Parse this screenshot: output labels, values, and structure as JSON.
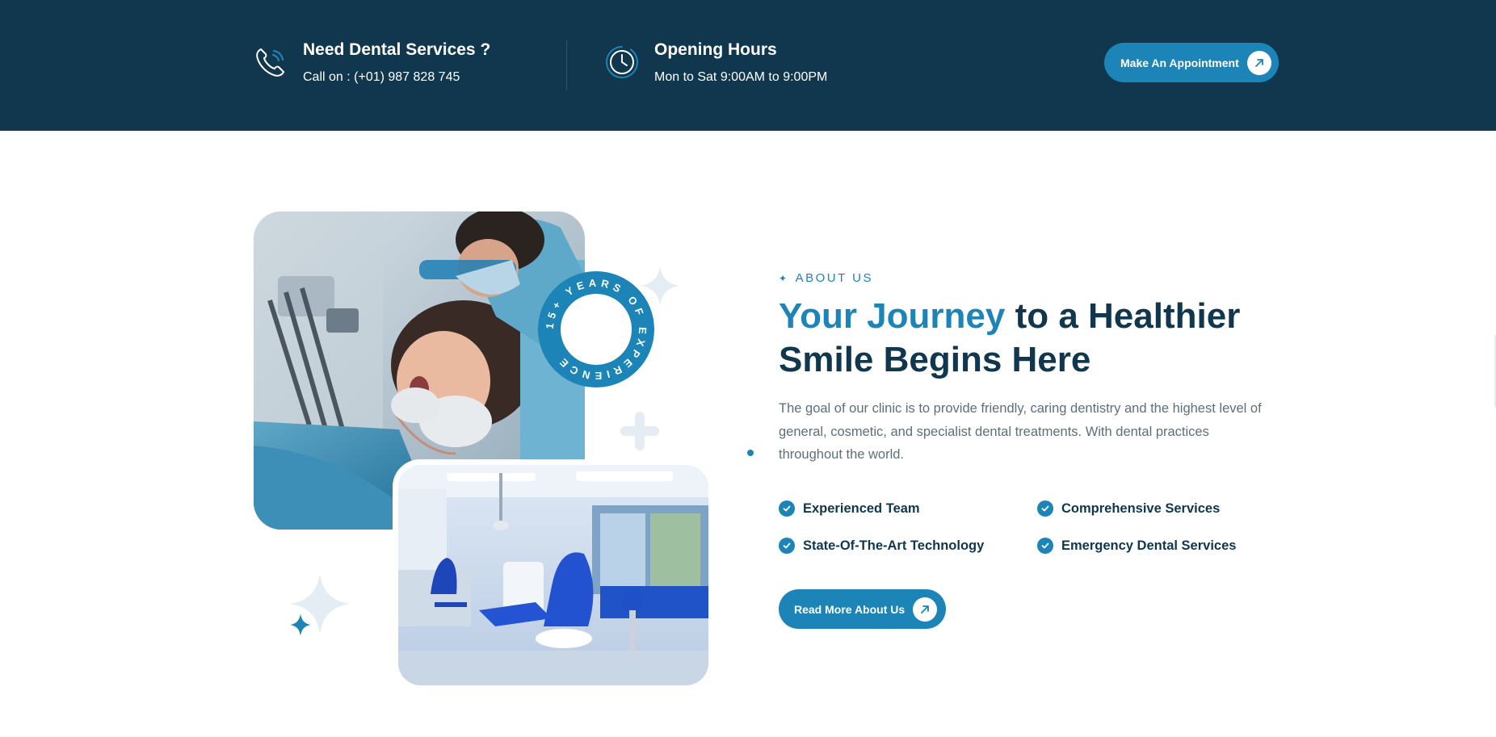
{
  "topbar": {
    "phone": {
      "title": "Need Dental Services ?",
      "text": "Call on : (+01) 987 828 745",
      "icon": "phone-icon"
    },
    "hours": {
      "title": "Opening Hours",
      "text": "Mon to Sat 9:00AM to 9:00PM",
      "icon": "clock-icon"
    },
    "appointment_label": "Make An Appointment"
  },
  "about": {
    "eyebrow": "ABOUT US",
    "heading_accent": "Your Journey",
    "heading_rest": " to a Healthier Smile Begins Here",
    "paragraph": "The goal of our clinic is to provide friendly, caring dentistry and the highest level of general, cosmetic, and specialist dental treatments. With dental practices throughout the world.",
    "features": [
      "Experienced Team",
      "Comprehensive Services",
      "State-Of-The-Art Technology",
      "Emergency Dental Services"
    ],
    "button_label": "Read More About Us",
    "badge_text": "15+ YEARS OF EXPERIENCE"
  },
  "colors": {
    "navy": "#10374d",
    "accent": "#1c84b7",
    "text_muted": "#5d6f7a"
  }
}
